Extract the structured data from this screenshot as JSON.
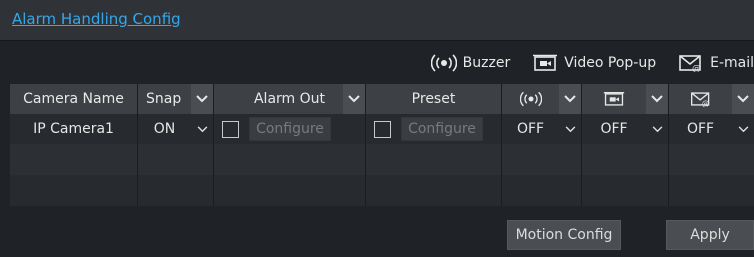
{
  "header": {
    "title": "Alarm Handling Config"
  },
  "legend": {
    "buzzer": "Buzzer",
    "video_popup": "Video Pop-up",
    "email": "E-mail"
  },
  "table": {
    "columns": {
      "camera_name": "Camera Name",
      "snap": "Snap",
      "alarm_out": "Alarm Out",
      "preset": "Preset"
    },
    "rows": [
      {
        "camera_name": "IP Camera1",
        "snap": "ON",
        "alarm_out_configure": "Configure",
        "preset_configure": "Configure",
        "buzzer": "OFF",
        "video_popup": "OFF",
        "email": "OFF"
      }
    ]
  },
  "buttons": {
    "motion_config": "Motion Config",
    "apply": "Apply"
  },
  "colors": {
    "accent": "#35a7e8",
    "background": "#1f2226"
  }
}
